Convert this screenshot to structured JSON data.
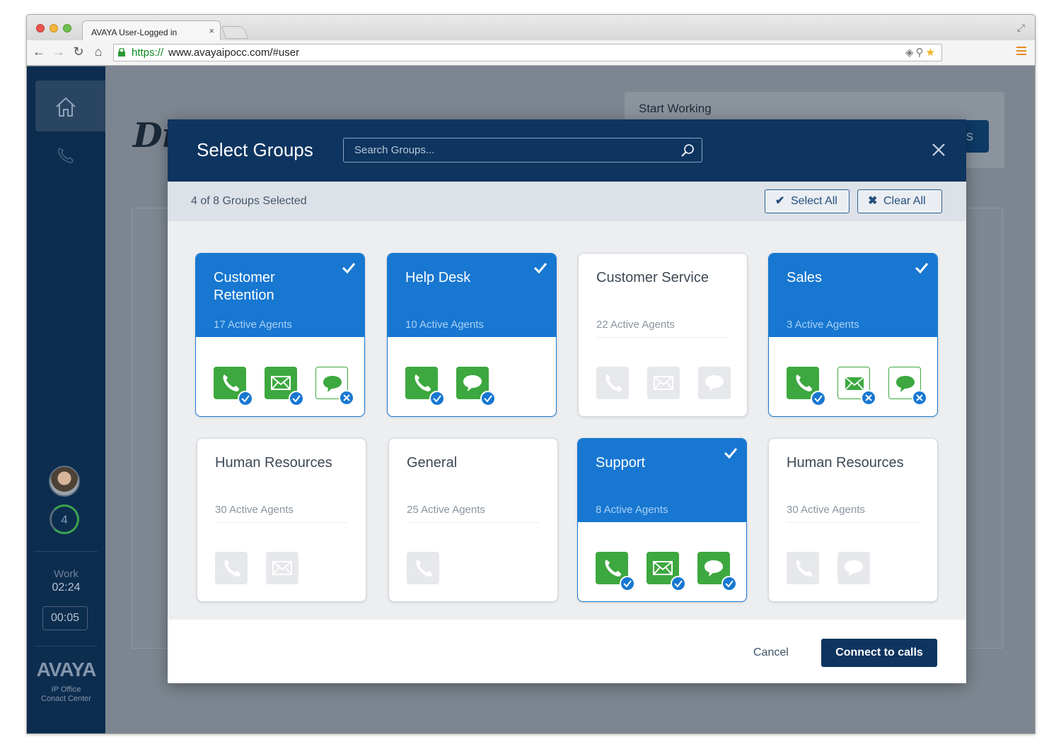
{
  "browser": {
    "tab_title": "AVAYA User-Logged in",
    "tab_close": "×",
    "url_protocol": "https://",
    "url_rest": "www.avayaipocc.com/#user"
  },
  "sidebar": {
    "agent_count": "4",
    "work_label": "Work",
    "work_time": "02:24",
    "timer": "00:05",
    "brand": "AVAYA",
    "brand_sub_1": "IP Office",
    "brand_sub_2": "Conact Center"
  },
  "background": {
    "start_working": "Start Working",
    "button_fragment": "s",
    "logo_fragment": "Di"
  },
  "modal": {
    "title": "Select Groups",
    "search_placeholder": "Search Groups...",
    "selected_count": "4 of 8 Groups Selected",
    "select_all": "Select All",
    "clear_all": "Clear All",
    "cancel": "Cancel",
    "connect": "Connect to calls",
    "groups": [
      {
        "name": "Customer Retention",
        "agents": "17 Active Agents",
        "selected": true
      },
      {
        "name": "Help Desk",
        "agents": "10 Active Agents",
        "selected": true
      },
      {
        "name": "Customer Service",
        "agents": "22 Active Agents",
        "selected": false
      },
      {
        "name": "Sales",
        "agents": "3 Active Agents",
        "selected": true
      },
      {
        "name": "Human Resources",
        "agents": "30 Active Agents",
        "selected": false
      },
      {
        "name": "General",
        "agents": "25 Active Agents",
        "selected": false
      },
      {
        "name": "Support",
        "agents": "8 Active Agents",
        "selected": true
      },
      {
        "name": "Human Resources",
        "agents": "30 Active Agents",
        "selected": false
      }
    ]
  },
  "colors": {
    "header_navy": "#0e3560",
    "selected_blue": "#1777d1",
    "channel_green": "#3da83f"
  }
}
